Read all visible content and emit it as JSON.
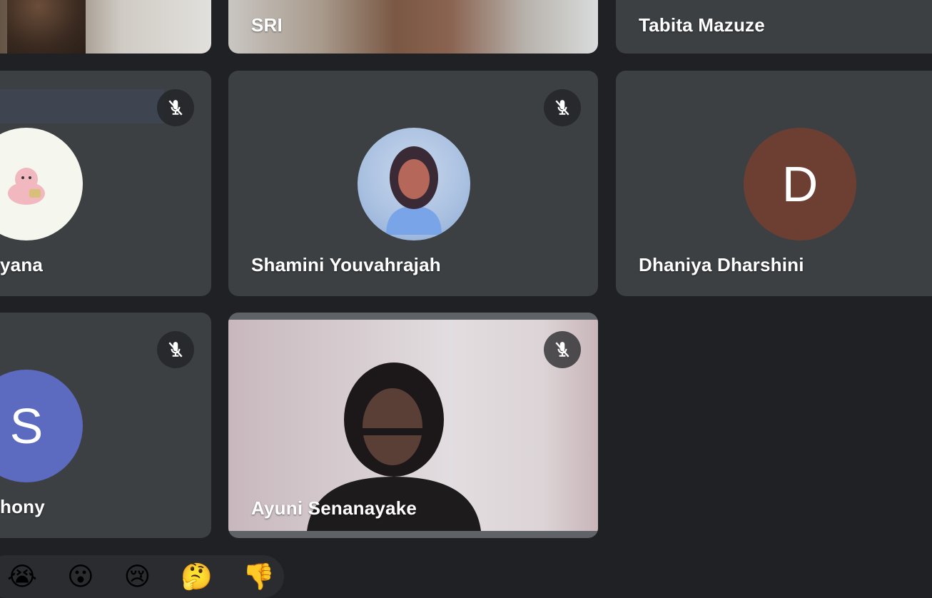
{
  "participants": {
    "top_left": {
      "name": ""
    },
    "top_middle": {
      "name": "SRI"
    },
    "top_right": {
      "name": "Tabita Mazuze"
    },
    "mid_left": {
      "name": "yana"
    },
    "mid_middle": {
      "name": "Shamini Youvahrajah"
    },
    "mid_right": {
      "name": "Dhaniya Dharshini",
      "initial": "D",
      "avatar_color": "#6d3f33"
    },
    "bottom_left": {
      "name": "hony",
      "initial": "S",
      "avatar_color": "#5c6bc0"
    },
    "bottom_middle": {
      "name": "Ayuni Senanayake"
    }
  },
  "mic_icon": "mic-off-icon",
  "reactions": [
    "😭",
    "😮",
    "😢",
    "🤔",
    "👎"
  ],
  "colors": {
    "background": "#202124",
    "tile": "#3c4043",
    "highlight_tile": "#5f6368"
  }
}
